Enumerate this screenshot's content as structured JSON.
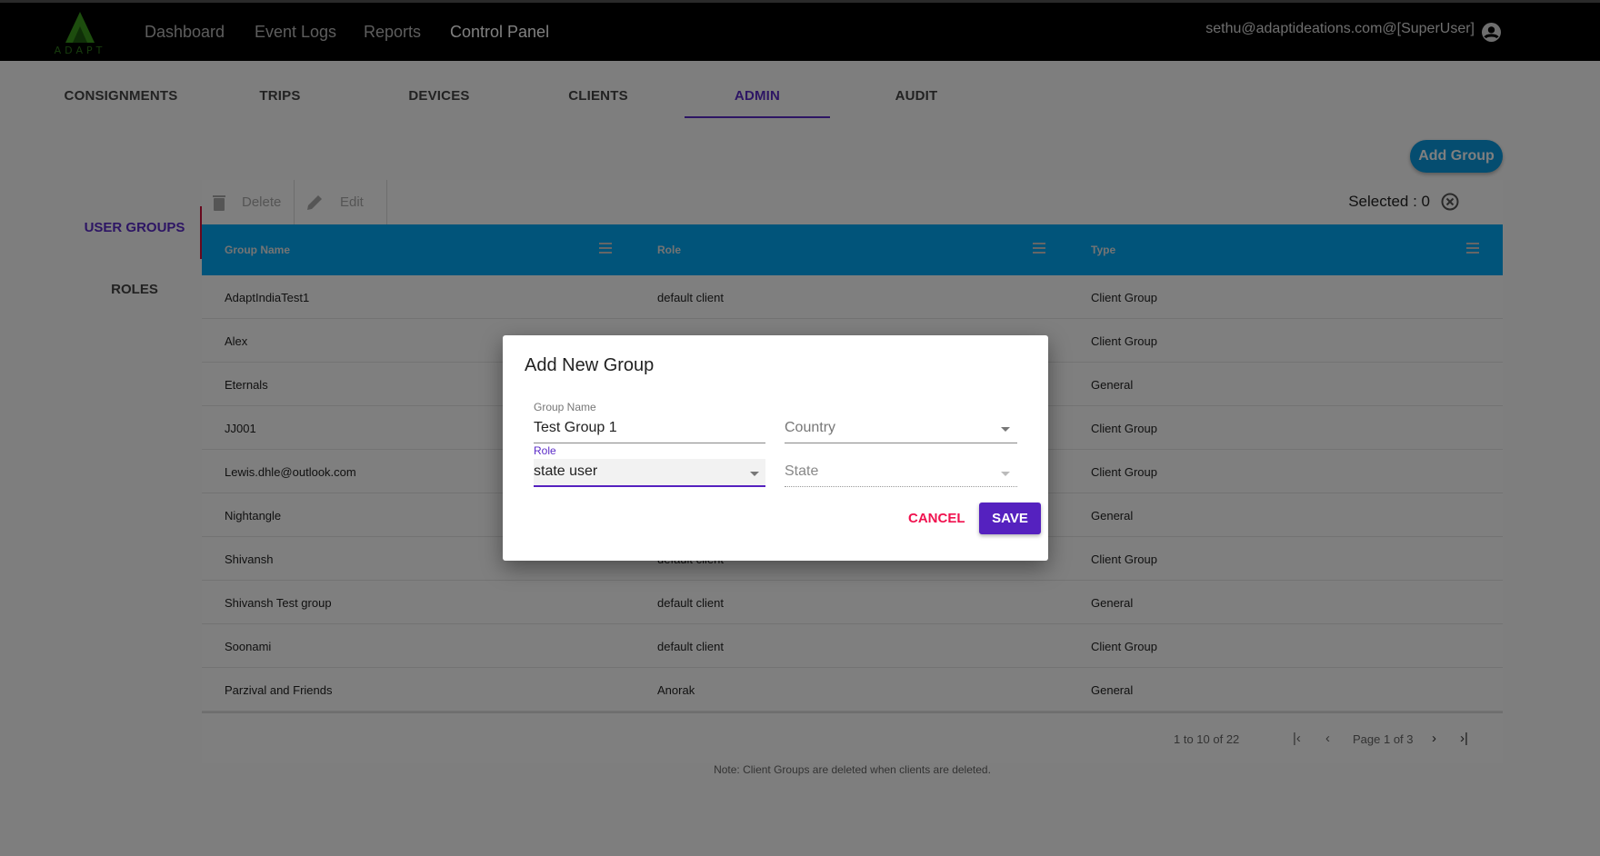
{
  "topbar": {
    "logo_text": "ADAPT",
    "nav": [
      "Dashboard",
      "Event Logs",
      "Reports",
      "Control Panel"
    ],
    "active_nav": "Control Panel",
    "user": "sethu@adaptideations.com@[SuperUser]"
  },
  "tabs": [
    "CONSIGNMENTS",
    "TRIPS",
    "DEVICES",
    "CLIENTS",
    "ADMIN",
    "AUDIT"
  ],
  "active_tab": "ADMIN",
  "add_group_label": "Add Group",
  "toolbar": {
    "delete": "Delete",
    "edit": "Edit",
    "selected": "Selected : 0"
  },
  "sidebar": [
    "USER GROUPS",
    "ROLES"
  ],
  "table": {
    "columns": [
      "Group Name",
      "Role",
      "Type"
    ],
    "rows": [
      [
        "AdaptIndiaTest1",
        "default client",
        "Client Group"
      ],
      [
        "Alex",
        "",
        "Client Group"
      ],
      [
        "Eternals",
        "",
        "General"
      ],
      [
        "JJ001",
        "",
        "Client Group"
      ],
      [
        "Lewis.dhle@outlook.com",
        "",
        "Client Group"
      ],
      [
        "Nightangle",
        "",
        "General"
      ],
      [
        "Shivansh",
        "default client",
        "Client Group"
      ],
      [
        "Shivansh Test group",
        "default client",
        "General"
      ],
      [
        "Soonami",
        "default client",
        "Client Group"
      ],
      [
        "Parzival and Friends",
        "Anorak",
        "General"
      ]
    ]
  },
  "pager": {
    "range": "1 to 10 of 22",
    "page": "Page 1 of 3"
  },
  "note": "Note: Client Groups are deleted when clients are deleted.",
  "dialog": {
    "title": "Add New Group",
    "group_name_label": "Group Name",
    "group_name_value": "Test Group 1",
    "country_placeholder": "Country",
    "role_label": "Role",
    "role_value": "state user",
    "state_placeholder": "State",
    "cancel": "CANCEL",
    "save": "SAVE"
  },
  "colors": {
    "header": "#03a9f4",
    "accent": "#5b2bc8",
    "cancel": "#f0124f",
    "save": "#5521bf"
  }
}
